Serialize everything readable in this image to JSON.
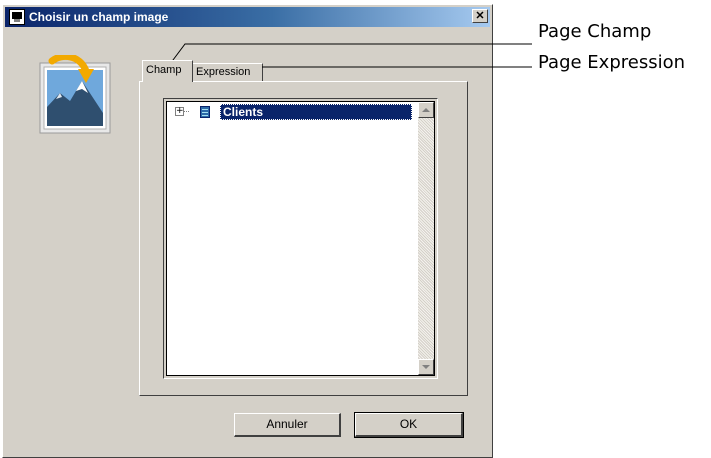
{
  "dialog": {
    "title": "Choisir un champ image",
    "close_glyph": "✕",
    "tabs": [
      {
        "label": "Champ",
        "active": true
      },
      {
        "label": "Expression",
        "active": false
      }
    ],
    "tree": {
      "items": [
        {
          "label": "Clients",
          "expander": "+",
          "icon": "table-icon",
          "selected": true
        }
      ]
    },
    "buttons": {
      "cancel": "Annuler",
      "ok": "OK"
    }
  },
  "callouts": {
    "champ": "Page Champ",
    "expression": "Page Expression"
  },
  "colors": {
    "dialog_bg": "#d4d0c8",
    "title_start": "#0a246a",
    "title_end": "#a6caf0",
    "selection": "#0a246a"
  }
}
